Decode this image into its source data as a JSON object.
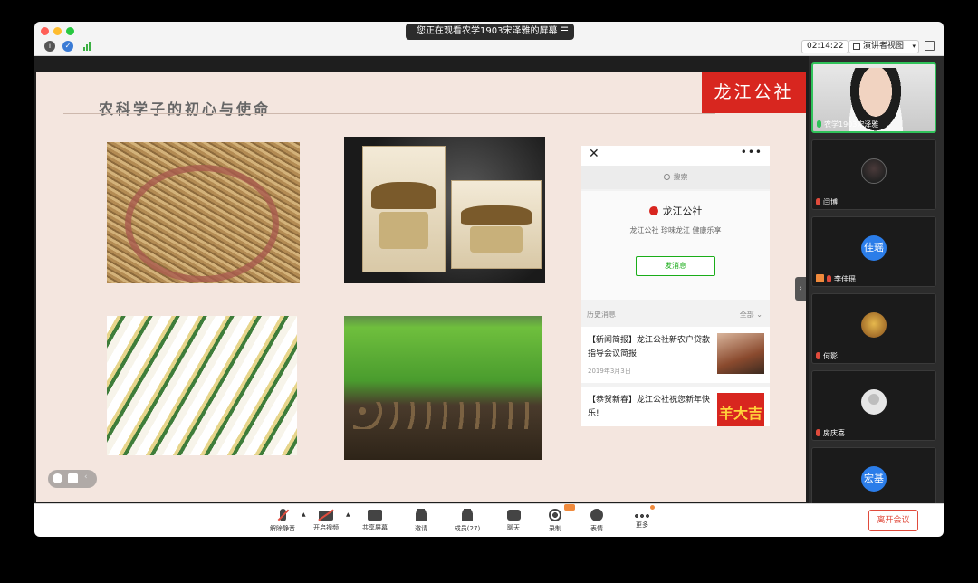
{
  "window": {
    "share_banner": "您正在观看农学1903宋泽雅的屏幕",
    "timer": "02:14:22",
    "view_mode": "演讲者视图"
  },
  "slide": {
    "title": "农科学子的初心与使命",
    "brand": "龙江公社"
  },
  "wechat_panel": {
    "search_placeholder": "搜索",
    "account_name": "龙江公社",
    "slogan": "龙江公社 珍味龙江 健康乐享",
    "send_button": "发消息",
    "history_label": "历史消息",
    "filter_label": "全部",
    "articles": [
      {
        "title": "【新闻简报】龙江公社新农户贷款指导会议简报",
        "date": "2019年3月3日"
      },
      {
        "title": "【恭贺新春】龙江公社祝您新年快乐!",
        "date": "",
        "thumb_text": "羊大吉"
      }
    ]
  },
  "participants": [
    {
      "name": "农学1903宋泽雅",
      "mic": "on",
      "active": true,
      "avatar": "video"
    },
    {
      "name": "闫博",
      "mic": "off",
      "active": false,
      "avatar": "photo"
    },
    {
      "name": "李佳瑶",
      "mic": "off",
      "active": false,
      "avatar": "text",
      "avatar_text": "佳瑶",
      "video_off": true
    },
    {
      "name": "何影",
      "mic": "off",
      "active": false,
      "avatar": "photo-cat"
    },
    {
      "name": "房庆喜",
      "mic": "off",
      "active": false,
      "avatar": "default"
    },
    {
      "name": "",
      "mic": "off",
      "active": false,
      "avatar": "text",
      "avatar_text": "宏基"
    }
  ],
  "toolbar": {
    "unmute": "解除静音",
    "start_video": "开启视频",
    "share_screen": "共享屏幕",
    "invite": "邀请",
    "participants": "成员(27)",
    "chat": "聊天",
    "record": "录制",
    "reactions": "表情",
    "more": "更多",
    "leave": "离开会议"
  },
  "colors": {
    "brand_red": "#d8261f",
    "wechat_green": "#1aad19",
    "active_speaker": "#30c25a",
    "leave_red": "#e04b3c"
  }
}
